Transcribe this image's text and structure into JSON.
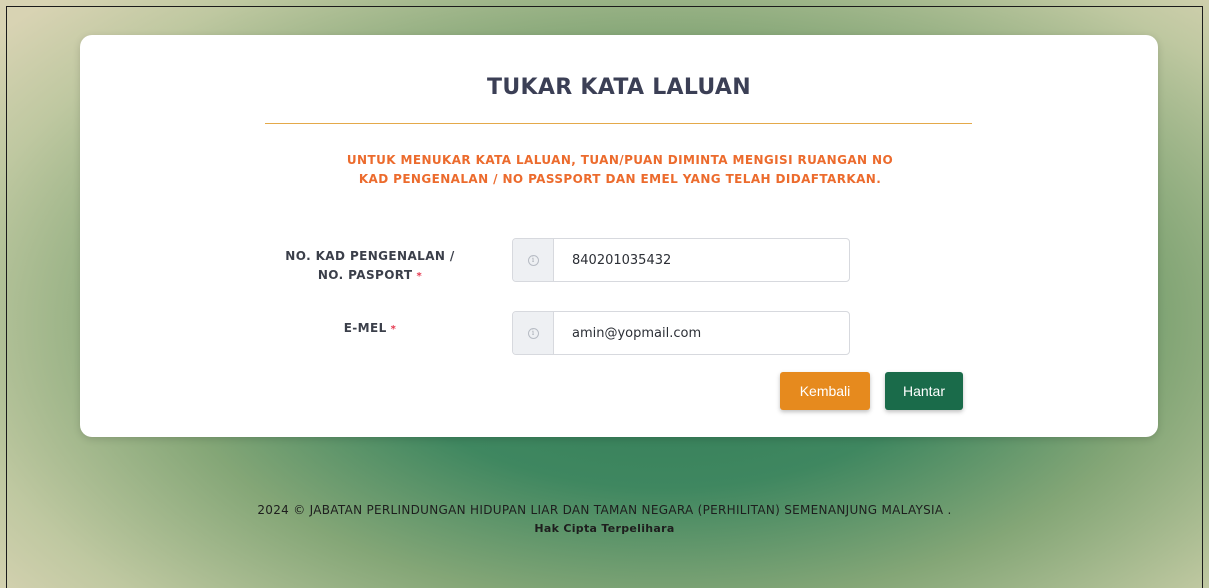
{
  "form": {
    "title": "TUKAR KATA LALUAN",
    "instruction": "UNTUK MENUKAR KATA LALUAN, TUAN/PUAN DIMINTA MENGISI RUANGAN NO KAD PENGENALAN / NO PASSPORT DAN EMEL YANG TELAH DIDAFTARKAN.",
    "ic_label_line1": "NO. KAD PENGENALAN /",
    "ic_label_line2": "NO. PASPORT",
    "ic_value": "840201035432",
    "email_label": "E-MEL",
    "email_value": "amin@yopmail.com",
    "required_marker": "*",
    "info_icon_glyph": "i",
    "back_label": "Kembali",
    "submit_label": "Hantar"
  },
  "footer": {
    "line1": "2024 © JABATAN PERLINDUNGAN HIDUPAN LIAR DAN TAMAN NEGARA (PERHILITAN) SEMENANJUNG MALAYSIA .",
    "line2": "Hak Cipta Terpelihara"
  },
  "colors": {
    "title": "#3b3f55",
    "instruction": "#ec6b2d",
    "divider": "#e4a94a",
    "back_button": "#e68a1e",
    "submit_button": "#1a6b4a",
    "required": "#e53950"
  },
  "icons": {
    "field_addon": "info-circle-icon"
  }
}
